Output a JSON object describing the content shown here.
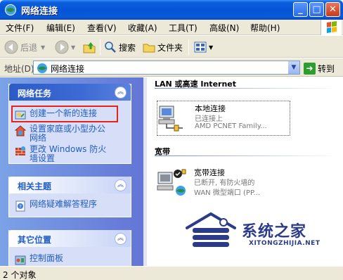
{
  "window": {
    "title": "网络连接"
  },
  "menu": [
    "文件(F)",
    "编辑(E)",
    "查看(V)",
    "收藏(A)",
    "工具(T)",
    "高级(N)",
    "帮助(H)"
  ],
  "toolbar": {
    "back": "后退",
    "search": "搜索",
    "folders": "文件夹"
  },
  "address": {
    "label": "地址(D)",
    "value": "网络连接",
    "go": "转到"
  },
  "tasks_panel": {
    "title": "网络任务",
    "items": [
      "创建一个新的连接",
      "设置家庭或小型办公\n网络",
      "更改 Windows 防火\n墙设置"
    ]
  },
  "related_panel": {
    "title": "相关主题",
    "items": [
      "网络疑难解答程序"
    ]
  },
  "other_panel": {
    "title": "其它位置",
    "items": [
      "控制面板"
    ]
  },
  "groups": [
    {
      "title": "LAN 或高速 Internet",
      "connection": {
        "name": "本地连接",
        "status": "已连接上",
        "device": "AMD PCNET Family..."
      }
    },
    {
      "title": "宽带",
      "connection": {
        "name": "宽带连接",
        "status": "已断开, 有防火墙的",
        "device": "WAN 微型端口 (PP..."
      }
    }
  ],
  "watermark": {
    "name": "系统之家",
    "url": "XITONGZHIJIA.NET"
  },
  "status": {
    "text": "2 个对象"
  }
}
